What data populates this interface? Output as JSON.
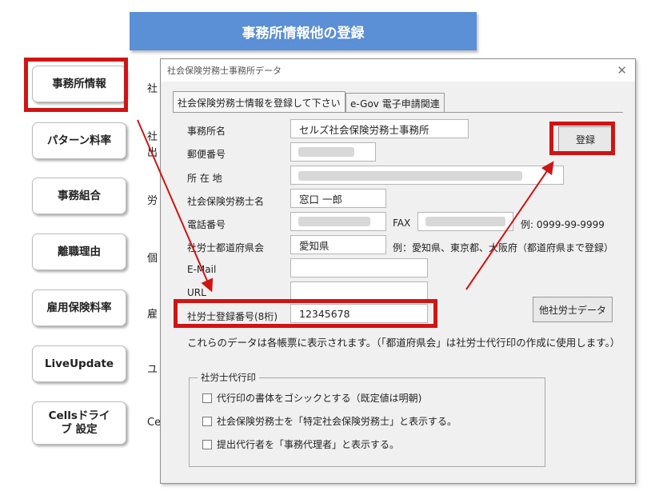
{
  "header": {
    "title": "事務所情報他の登録"
  },
  "sidebar": {
    "items": [
      {
        "label": "事務所情報"
      },
      {
        "label": "パターン料率"
      },
      {
        "label": "事務組合"
      },
      {
        "label": "離職理由"
      },
      {
        "label": "雇用保険料率"
      },
      {
        "label": "LiveUpdate"
      },
      {
        "label": "Cellsドライブ 設定"
      }
    ],
    "bg_labels": [
      "社",
      "社",
      "出",
      "労",
      "個",
      "雇",
      "ユ",
      "Ce"
    ]
  },
  "dialog": {
    "title": "社会保険労務士事務所データ",
    "close": "✕",
    "tabs": [
      "社会保険労務士情報を登録して下さい",
      "e-Gov 電子申請関連"
    ],
    "fields": {
      "office_name_label": "事務所名",
      "office_name_value": "セルズ社会保険労務士事務所",
      "postal_label": "郵便番号",
      "address_label": "所 在 地",
      "sharoushi_name_label": "社会保険労務士名",
      "sharoushi_name_value": "窓口 一郎",
      "phone_label": "電話番号",
      "fax_label": "FAX",
      "phone_example": "例:  0999-99-9999",
      "prefecture_label": "社労士都道府県会",
      "prefecture_value": "愛知県",
      "prefecture_example": "例：愛知県、東京都、大阪府（都道府県まで登録）",
      "email_label": "E-Mail",
      "url_label": "URL",
      "reg_number_label": "社労士登録番号(8桁)",
      "reg_number_value": "12345678"
    },
    "buttons": {
      "register": "登録",
      "other_sharoushi": "他社労士データ"
    },
    "note": "これらのデータは各帳票に表示されます。（「都道府県会」は社労士代行印の作成に使用します。）",
    "group": {
      "title": "社労士代行印",
      "options": [
        "代行印の書体をゴシックとする（既定値は明朝)",
        "社会保険労務士を「特定社会保険労務士」と表示する。",
        "提出代行者を「事務代理者」と表示する。"
      ]
    }
  }
}
